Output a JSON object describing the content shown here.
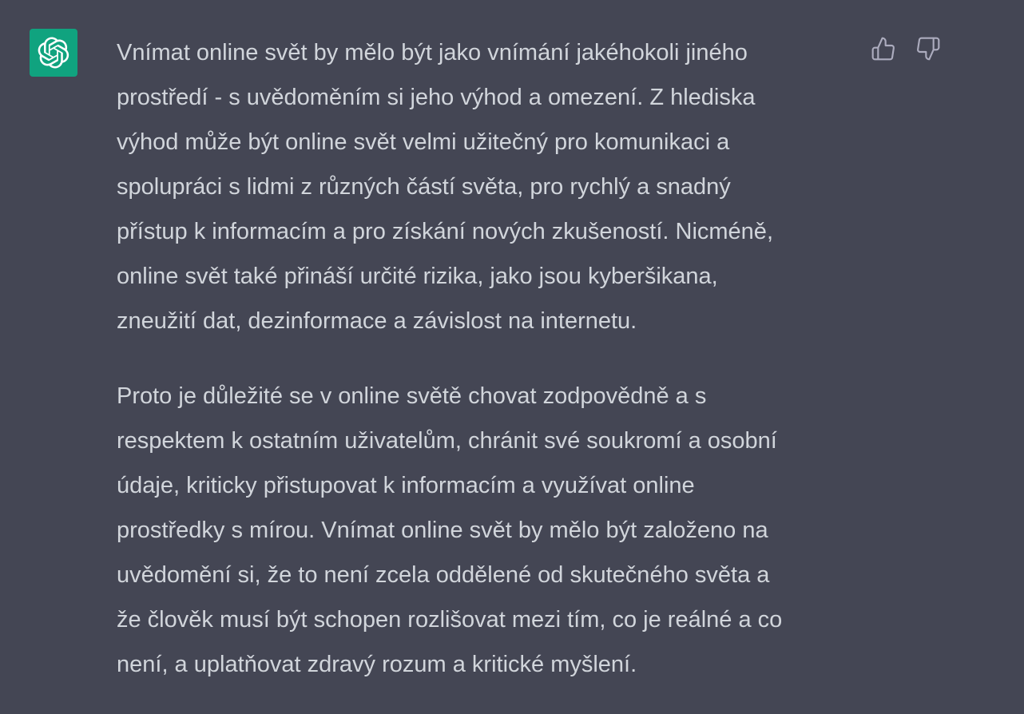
{
  "assistant": {
    "avatar_icon": "openai-logo-icon",
    "avatar_color": "#10a37f"
  },
  "message": {
    "paragraphs": [
      {
        "lines": [
          "Vnímat online svět by mělo být jako vnímání jakéhokoli jiného",
          "prostředí - s uvědoměním si jeho výhod a omezení. Z hlediska",
          "výhod může být online svět velmi užitečný pro komunikaci a",
          "spolupráci s lidmi z různých částí světa, pro rychlý a snadný",
          "přístup k informacím a pro získání nových zkušeností. Nicméně,",
          "online svět také přináší určité rizika, jako jsou kyberšikana,",
          "zneužití dat, dezinformace a závislost na internetu."
        ]
      },
      {
        "lines": [
          "Proto je důležité se v online světě chovat zodpovědně a s",
          "respektem k ostatním uživatelům, chránit své soukromí a osobní",
          "údaje, kriticky přistupovat k informacím a využívat online",
          "prostředky s mírou. Vnímat online svět by mělo být založeno na",
          "uvědomění si, že to není zcela oddělené od skutečného světa a",
          "že člověk musí být schopen rozlišovat mezi tím, co je reálné a co",
          "není, a uplatňovat zdravý rozum a kritické myšlení."
        ]
      }
    ]
  },
  "feedback": {
    "thumbs_up_icon": "thumbs-up-icon",
    "thumbs_down_icon": "thumbs-down-icon"
  },
  "colors": {
    "background": "#444654",
    "text": "#d1d5db",
    "icon": "#acacbe"
  }
}
